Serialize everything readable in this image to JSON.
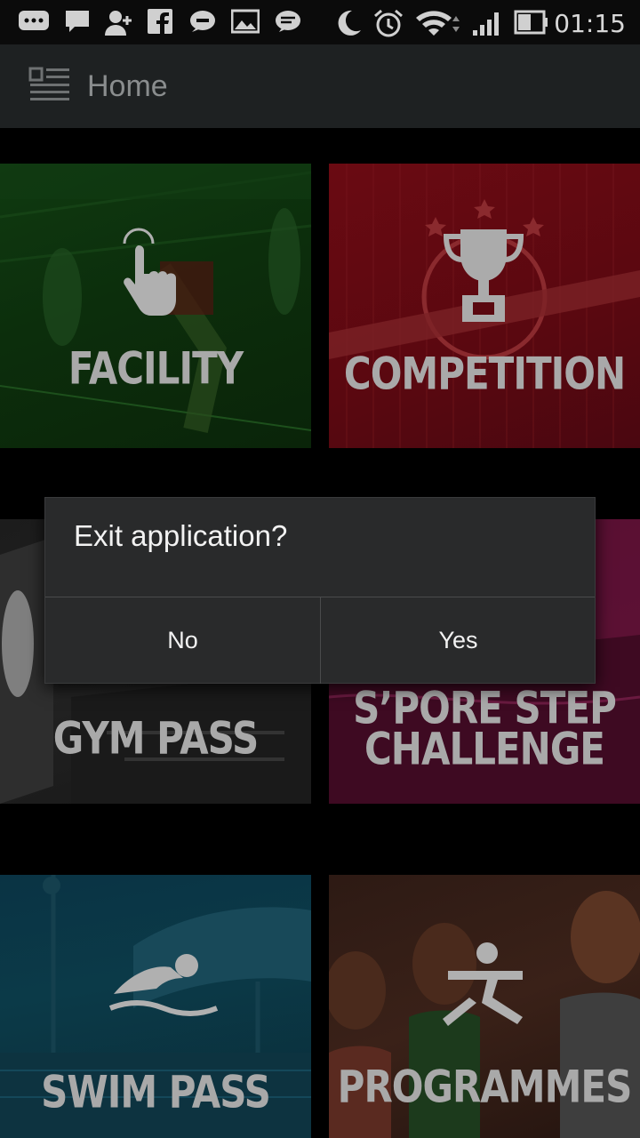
{
  "status_bar": {
    "time": "01:15",
    "icons": [
      "message-icon",
      "chat-icon",
      "add-contact-icon",
      "facebook-icon",
      "sms-icon",
      "gallery-icon",
      "messenger-icon",
      "night-mode-icon",
      "alarm-icon",
      "wifi-icon",
      "signal-icon",
      "battery-icon"
    ]
  },
  "app_bar": {
    "title": "Home",
    "menu_icon": "menu-list-icon"
  },
  "tiles": [
    {
      "label": "FACILITY",
      "icon": "tap-hand-icon",
      "color": "#0c2e0c"
    },
    {
      "label": "COMPETITION",
      "icon": "trophy-icon",
      "color": "#5a0810"
    },
    {
      "label": "GYM PASS",
      "icon": "",
      "color": "#1c1c1c"
    },
    {
      "label_line1": "S’PORE STEP",
      "label_line2": "CHALLENGE",
      "icon": "",
      "color": "#4c0b2c"
    },
    {
      "label": "SWIM PASS",
      "icon": "swimmer-icon",
      "color": "#0a3344"
    },
    {
      "label": "PROGRAMMES",
      "icon": "exercise-icon",
      "color": "#2d1a14"
    }
  ],
  "dialog": {
    "message": "Exit application?",
    "negative_label": "No",
    "positive_label": "Yes"
  }
}
